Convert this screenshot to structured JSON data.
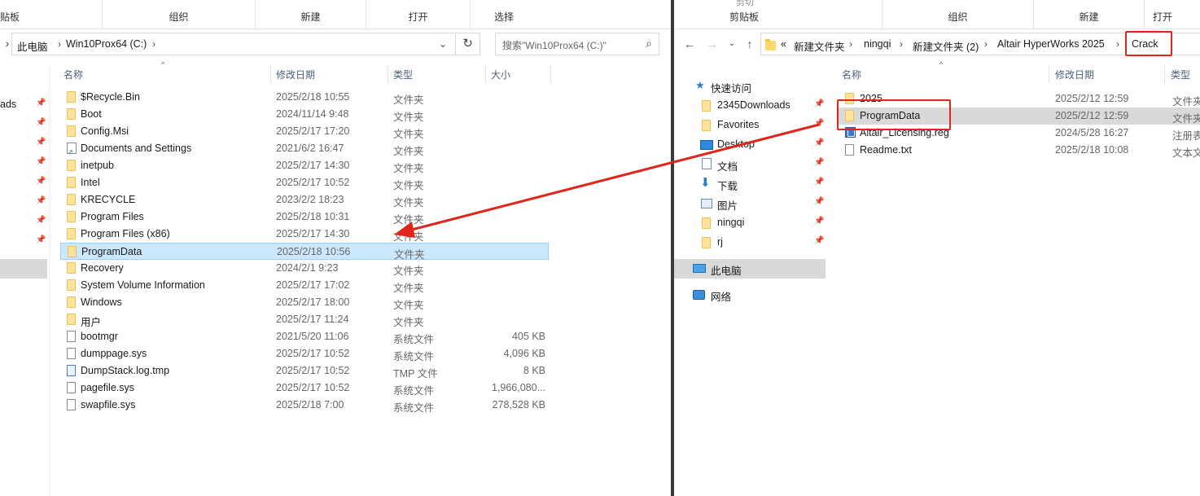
{
  "left": {
    "ribbon": {
      "groups": [
        "组织",
        "新建",
        "打开",
        "选择"
      ],
      "stub_right": "贴板"
    },
    "address": {
      "crumbs": [
        "此电脑",
        "Win10Prox64 (C:)"
      ],
      "search_placeholder": "搜索\"Win10Prox64 (C:)\""
    },
    "nav_partial": [
      "ads"
    ],
    "columns": {
      "name": "名称",
      "date": "修改日期",
      "type": "类型",
      "size": "大小"
    },
    "rows": [
      {
        "name": "$Recycle.Bin",
        "date": "2025/2/18 10:55",
        "type": "文件夹",
        "size": "",
        "icon": "folder-icon"
      },
      {
        "name": "Boot",
        "date": "2024/11/14 9:48",
        "type": "文件夹",
        "size": "",
        "icon": "folder-icon"
      },
      {
        "name": "Config.Msi",
        "date": "2025/2/17 17:20",
        "type": "文件夹",
        "size": "",
        "icon": "folder-icon"
      },
      {
        "name": "Documents and Settings",
        "date": "2021/6/2 16:47",
        "type": "文件夹",
        "size": "",
        "icon": "shortcut-icon"
      },
      {
        "name": "inetpub",
        "date": "2025/2/17 14:30",
        "type": "文件夹",
        "size": "",
        "icon": "folder-icon"
      },
      {
        "name": "Intel",
        "date": "2025/2/17 10:52",
        "type": "文件夹",
        "size": "",
        "icon": "folder-icon"
      },
      {
        "name": "KRECYCLE",
        "date": "2023/2/2 18:23",
        "type": "文件夹",
        "size": "",
        "icon": "folder-icon"
      },
      {
        "name": "Program Files",
        "date": "2025/2/18 10:31",
        "type": "文件夹",
        "size": "",
        "icon": "folder-icon"
      },
      {
        "name": "Program Files (x86)",
        "date": "2025/2/17 14:30",
        "type": "文件夹",
        "size": "",
        "icon": "folder-icon"
      },
      {
        "name": "ProgramData",
        "date": "2025/2/18 10:56",
        "type": "文件夹",
        "size": "",
        "icon": "folder-icon",
        "selected": true
      },
      {
        "name": "Recovery",
        "date": "2024/2/1 9:23",
        "type": "文件夹",
        "size": "",
        "icon": "folder-icon"
      },
      {
        "name": "System Volume Information",
        "date": "2025/2/17 17:02",
        "type": "文件夹",
        "size": "",
        "icon": "folder-icon"
      },
      {
        "name": "Windows",
        "date": "2025/2/17 18:00",
        "type": "文件夹",
        "size": "",
        "icon": "folder-icon"
      },
      {
        "name": "用户",
        "date": "2025/2/17 11:24",
        "type": "文件夹",
        "size": "",
        "icon": "folder-icon"
      },
      {
        "name": "bootmgr",
        "date": "2021/5/20 11:06",
        "type": "系统文件",
        "size": "405 KB",
        "icon": "file-icon"
      },
      {
        "name": "dumppage.sys",
        "date": "2025/2/17 10:52",
        "type": "系统文件",
        "size": "4,096 KB",
        "icon": "file-icon"
      },
      {
        "name": "DumpStack.log.tmp",
        "date": "2025/2/17 10:52",
        "type": "TMP 文件",
        "size": "8 KB",
        "icon": "file-icon-blue"
      },
      {
        "name": "pagefile.sys",
        "date": "2025/2/17 10:52",
        "type": "系统文件",
        "size": "1,966,080...",
        "icon": "file-icon"
      },
      {
        "name": "swapfile.sys",
        "date": "2025/2/18 7:00",
        "type": "系统文件",
        "size": "278,528 KB",
        "icon": "file-icon"
      }
    ]
  },
  "right": {
    "ribbon": {
      "groups": [
        "剪贴板",
        "组织",
        "新建"
      ],
      "stub_right": "打开",
      "stub_top": "剪切"
    },
    "address": {
      "prefix": "«",
      "crumbs": [
        "新建文件夹",
        "ningqi",
        "新建文件夹 (2)",
        "Altair HyperWorks 2025",
        "Crack"
      ]
    },
    "nav": {
      "quick_access": "快速访问",
      "items": [
        "2345Downloads",
        "Favorites",
        "Desktop",
        "文档",
        "下载",
        "图片",
        "ningqi",
        "rj"
      ],
      "this_pc": "此电脑",
      "network": "网络"
    },
    "columns": {
      "name": "名称",
      "date": "修改日期",
      "type": "类型"
    },
    "rows": [
      {
        "name": "2025",
        "date": "2025/2/12 12:59",
        "type": "文件夹",
        "icon": "folder-icon"
      },
      {
        "name": "ProgramData",
        "date": "2025/2/12 12:59",
        "type": "文件夹",
        "icon": "folder-icon",
        "highlighted": true
      },
      {
        "name": "Altair_Licensing.reg",
        "date": "2024/5/28 16:27",
        "type": "注册表",
        "icon": "registry-icon"
      },
      {
        "name": "Readme.txt",
        "date": "2025/2/18 10:08",
        "type": "文本文",
        "icon": "text-file-icon"
      }
    ]
  },
  "annotation": {
    "color": "#e0251b"
  }
}
